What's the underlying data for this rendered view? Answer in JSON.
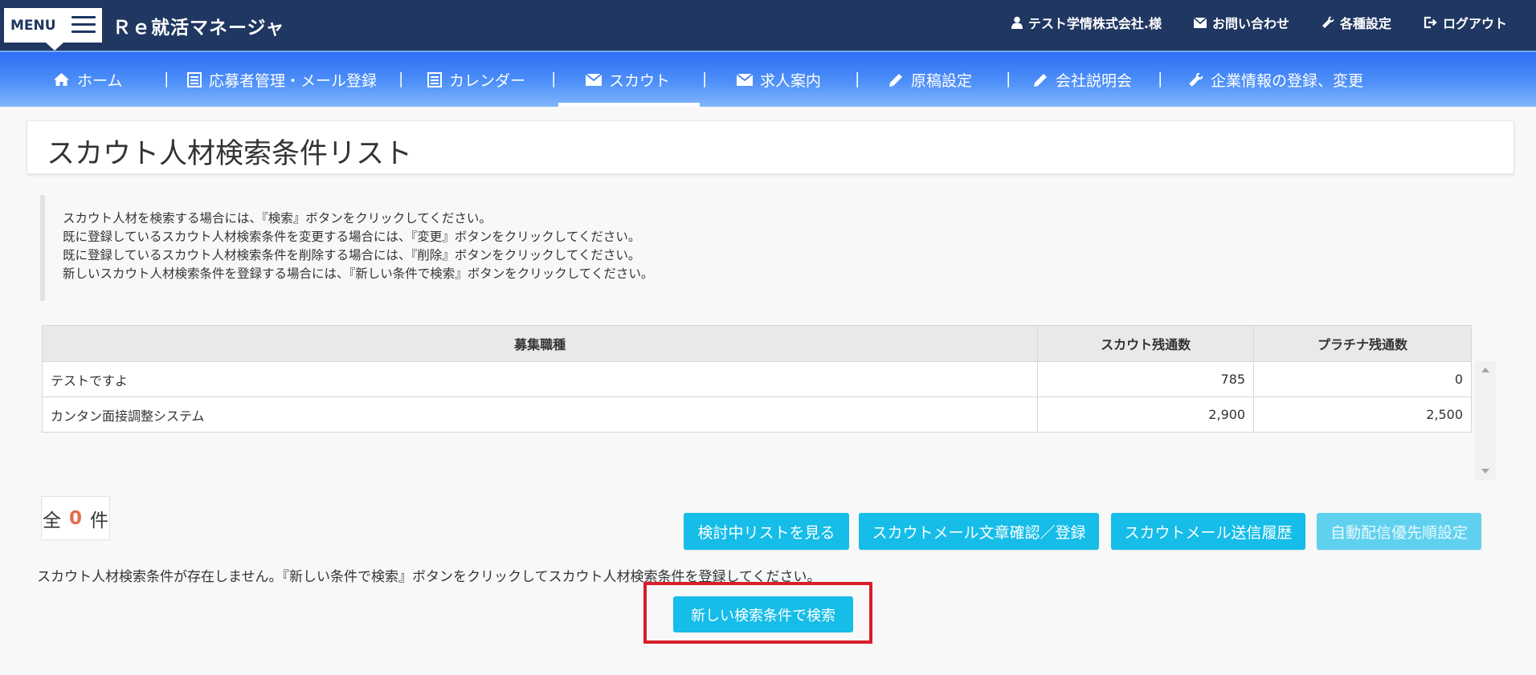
{
  "header": {
    "menu_label": "MENU",
    "brand": "Ｒｅ就活マネージャ",
    "user_label": "テスト学情株式会社.様",
    "contact_label": "お問い合わせ",
    "settings_label": "各種設定",
    "logout_label": "ログアウト"
  },
  "nav": {
    "items": [
      {
        "label": "ホーム",
        "icon": "home-icon"
      },
      {
        "label": "応募者管理・メール登録",
        "icon": "list-icon"
      },
      {
        "label": "カレンダー",
        "icon": "list-icon"
      },
      {
        "label": "スカウト",
        "icon": "envelope-icon"
      },
      {
        "label": "求人案内",
        "icon": "envelope-icon"
      },
      {
        "label": "原稿設定",
        "icon": "pencil-icon"
      },
      {
        "label": "会社説明会",
        "icon": "pencil-icon"
      },
      {
        "label": "企業情報の登録、変更",
        "icon": "wrench-icon"
      }
    ],
    "separator": "|",
    "active_index": 3
  },
  "page": {
    "title": "スカウト人材検索条件リスト",
    "instructions": [
      "スカウト人材を検索する場合には、『検索』ボタンをクリックしてください。",
      "既に登録しているスカウト人材検索条件を変更する場合には、『変更』ボタンをクリックしてください。",
      "既に登録しているスカウト人材検索条件を削除する場合には、『削除』ボタンをクリックしてください。",
      "新しいスカウト人材検索条件を登録する場合には、『新しい条件で検索』ボタンをクリックしてください。"
    ]
  },
  "table": {
    "headers": [
      "募集職種",
      "スカウト残通数",
      "プラチナ残通数"
    ],
    "rows": [
      {
        "job": "テストですよ",
        "scout": "785",
        "platinum": "0"
      },
      {
        "job": "カンタン面接調整システム",
        "scout": "2,900",
        "platinum": "2,500"
      }
    ]
  },
  "count": {
    "prefix": "全",
    "value": "0",
    "suffix": "件"
  },
  "actions": {
    "review_list": "検討中リストを見る",
    "mail_text": "スカウトメール文章確認／登録",
    "mail_history": "スカウトメール送信履歴",
    "auto_priority": "自動配信優先順設定"
  },
  "empty_message": "スカウト人材検索条件が存在しません。『新しい条件で検索』ボタンをクリックしてスカウト人材検索条件を登録してください。",
  "new_search_label": "新しい検索条件で検索",
  "colors": {
    "header_bg": "#1f3761",
    "nav_bg": "#3b7ff6",
    "button": "#15bde8",
    "count_accent": "#e36a4c",
    "highlight": "#d81e2a"
  }
}
